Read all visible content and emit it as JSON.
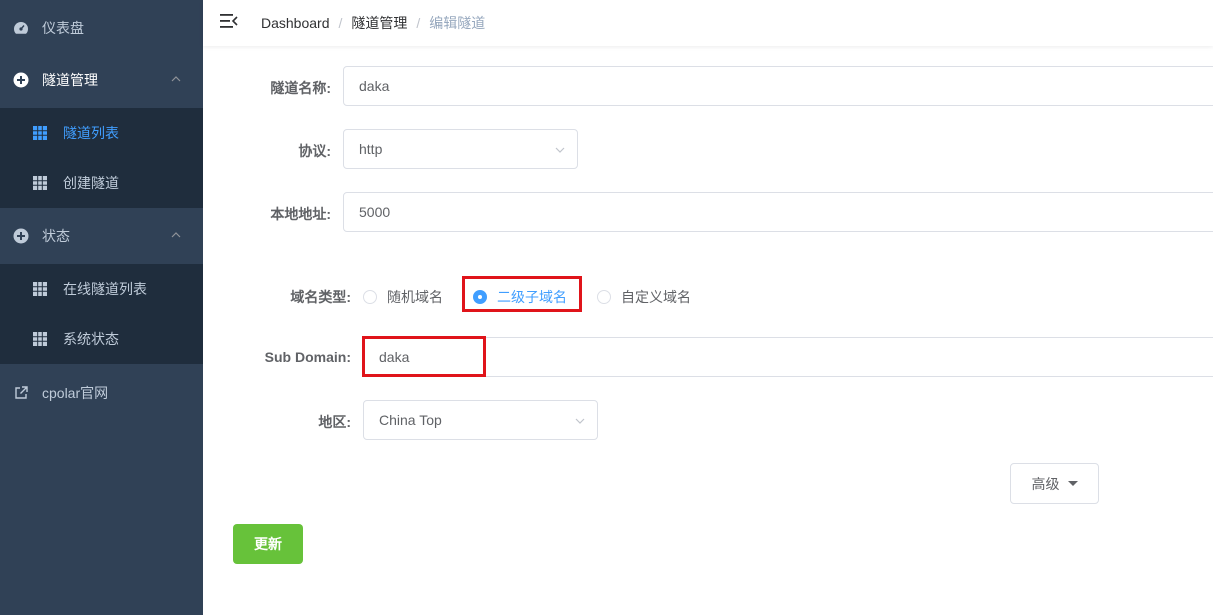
{
  "sidebar": {
    "dashboard": {
      "label": "仪表盘",
      "icon": "dashboard-icon"
    },
    "tunnel_mgmt": {
      "label": "隧道管理",
      "icon": "plus-circle-icon"
    },
    "tunnel_list": {
      "label": "隧道列表",
      "icon": "table-icon"
    },
    "create_tunnel": {
      "label": "创建隧道",
      "icon": "table-icon"
    },
    "status": {
      "label": "状态",
      "icon": "plus-circle-icon"
    },
    "online_tunnels": {
      "label": "在线隧道列表",
      "icon": "table-icon"
    },
    "system_status": {
      "label": "系统状态",
      "icon": "table-icon"
    },
    "cpolar_site": {
      "label": "cpolar官网",
      "icon": "external-link-icon"
    }
  },
  "breadcrumb": {
    "items": [
      "Dashboard",
      "隧道管理",
      "编辑隧道"
    ],
    "separator": "/"
  },
  "form": {
    "tunnel_name": {
      "label": "隧道名称:",
      "value": "daka"
    },
    "protocol": {
      "label": "协议:",
      "value": "http"
    },
    "local_address": {
      "label": "本地地址:",
      "value": "5000"
    },
    "domain_type": {
      "label": "域名类型:",
      "options": [
        "随机域名",
        "二级子域名",
        "自定义域名"
      ],
      "selected": "二级子域名"
    },
    "sub_domain": {
      "label": "Sub Domain:",
      "value": "daka"
    },
    "region": {
      "label": "地区:",
      "value": "China Top"
    }
  },
  "buttons": {
    "advanced": "高级",
    "update": "更新"
  },
  "colors": {
    "sidebar_bg": "#304156",
    "submenu_bg": "#1f2d3d",
    "active": "#409eff",
    "highlight_box": "#e0141a",
    "update_button": "#67c23a"
  }
}
